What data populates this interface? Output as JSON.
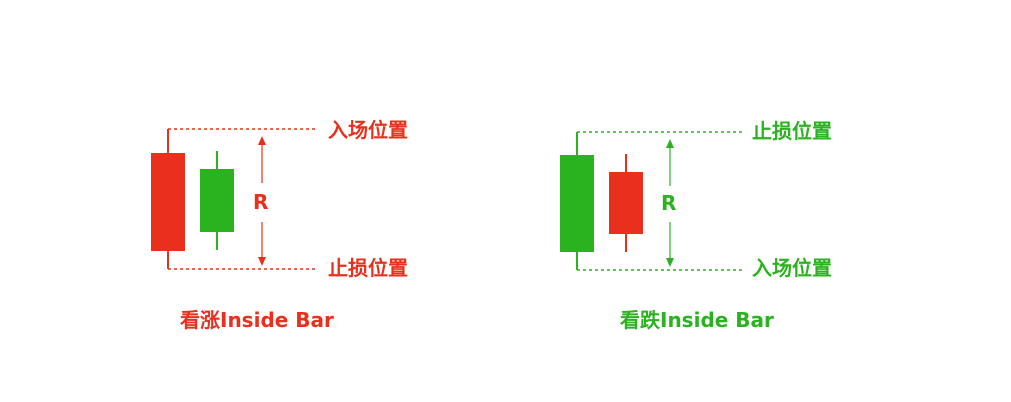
{
  "colors": {
    "red": "#e8301c",
    "green": "#2bb21f"
  },
  "bullish": {
    "caption": "看涨Inside Bar",
    "top_label": "入场位置",
    "bottom_label": "止损位置",
    "range_label": "R",
    "mother_candle": "bearish-red",
    "inside_candle": "bullish-green"
  },
  "bearish": {
    "caption": "看跌Inside Bar",
    "top_label": "止损位置",
    "bottom_label": "入场位置",
    "range_label": "R",
    "mother_candle": "bullish-green",
    "inside_candle": "bearish-red"
  }
}
